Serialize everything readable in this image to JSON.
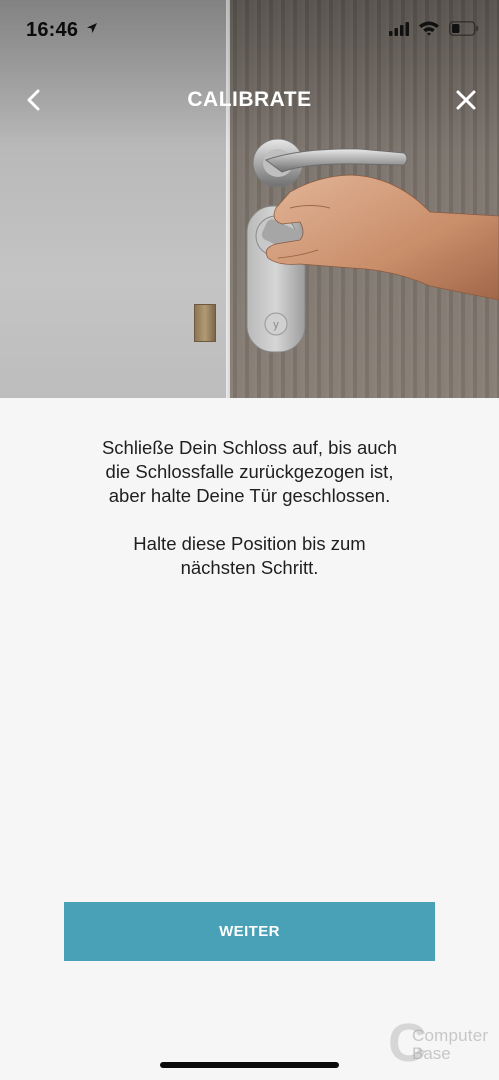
{
  "status_bar": {
    "time": "16:46",
    "icons": [
      "location-arrow-icon",
      "cellular-signal-icon",
      "wifi-icon",
      "battery-icon"
    ]
  },
  "nav": {
    "title": "CALIBRATE",
    "back_icon": "chevron-left-icon",
    "close_icon": "close-icon"
  },
  "hero": {
    "image": "door-lock-calibration-photo"
  },
  "instructions": {
    "paragraph_1_lines": [
      "Schließe Dein Schloss auf, bis auch",
      "die Schlossfalle zurückgezogen ist,",
      "aber halte Deine Tür geschlossen."
    ],
    "paragraph_2_lines": [
      "Halte diese Position bis zum",
      "nächsten Schritt."
    ]
  },
  "actions": {
    "next_label": "WEITER"
  },
  "watermark": {
    "line1": "Computer",
    "line2": "Base"
  },
  "colors": {
    "accent": "#48a1b6",
    "background": "#f6f6f6",
    "text": "#1f1f1f"
  }
}
